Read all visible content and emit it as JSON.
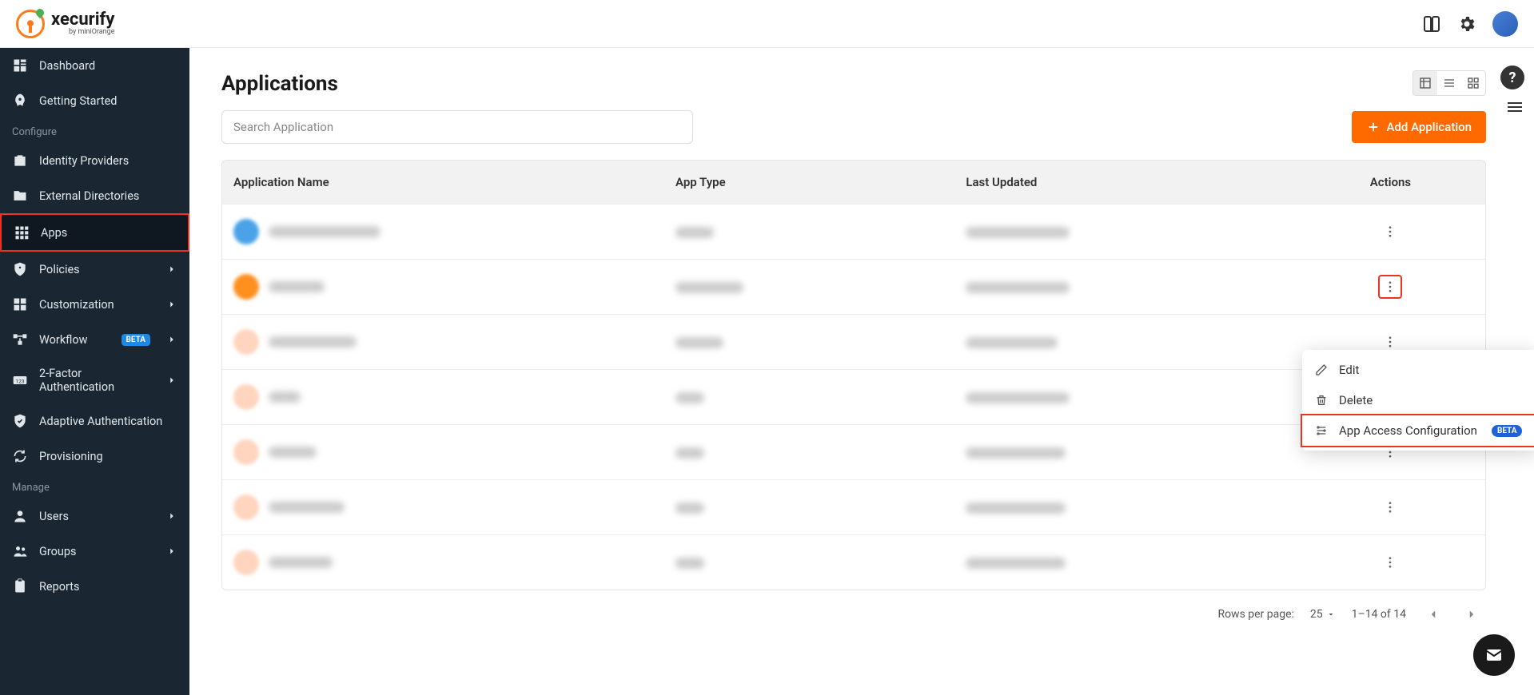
{
  "brand": {
    "name": "xecurify",
    "byline": "by miniOrange"
  },
  "topbar": {},
  "sidebar": {
    "items": [
      {
        "key": "dashboard",
        "label": "Dashboard",
        "icon": "grid"
      },
      {
        "key": "getting-started",
        "label": "Getting Started",
        "icon": "rocket"
      }
    ],
    "configure_label": "Configure",
    "configure": [
      {
        "key": "idp",
        "label": "Identity Providers",
        "icon": "briefcase"
      },
      {
        "key": "ext-dir",
        "label": "External Directories",
        "icon": "folder"
      },
      {
        "key": "apps",
        "label": "Apps",
        "icon": "apps",
        "active": true
      },
      {
        "key": "policies",
        "label": "Policies",
        "icon": "shield",
        "chevron": true
      },
      {
        "key": "custom",
        "label": "Customization",
        "icon": "puzzle",
        "chevron": true
      },
      {
        "key": "workflow",
        "label": "Workflow",
        "icon": "flow",
        "badge": "BETA",
        "chevron": true
      },
      {
        "key": "2fa",
        "label": "2-Factor Authentication",
        "icon": "pin",
        "chevron": true
      },
      {
        "key": "adaptive",
        "label": "Adaptive Authentication",
        "icon": "check-shield"
      },
      {
        "key": "prov",
        "label": "Provisioning",
        "icon": "sync"
      }
    ],
    "manage_label": "Manage",
    "manage": [
      {
        "key": "users",
        "label": "Users",
        "icon": "user",
        "chevron": true
      },
      {
        "key": "groups",
        "label": "Groups",
        "icon": "group",
        "chevron": true
      },
      {
        "key": "reports",
        "label": "Reports",
        "icon": "clipboard"
      }
    ]
  },
  "page": {
    "title": "Applications",
    "search_placeholder": "Search Application",
    "add_button": "Add Application",
    "columns": {
      "name": "Application Name",
      "type": "App Type",
      "updated": "Last Updated",
      "actions": "Actions"
    },
    "rows": [
      {
        "icon_color": "#4aa3e8",
        "name_w": 140,
        "type_w": 48,
        "upd_w": 130,
        "hl": false
      },
      {
        "icon_color": "#ff9020",
        "name_w": 70,
        "type_w": 85,
        "upd_w": 130,
        "hl": true
      },
      {
        "icon_color": "#ffd5c0",
        "name_w": 110,
        "type_w": 60,
        "upd_w": 115,
        "hl": false
      },
      {
        "icon_color": "#ffd5c0",
        "name_w": 40,
        "type_w": 36,
        "upd_w": 130,
        "hl": false
      },
      {
        "icon_color": "#ffd5c0",
        "name_w": 60,
        "type_w": 36,
        "upd_w": 125,
        "hl": false
      },
      {
        "icon_color": "#ffd5c0",
        "name_w": 95,
        "type_w": 36,
        "upd_w": 125,
        "hl": false
      },
      {
        "icon_color": "#ffd5c0",
        "name_w": 80,
        "type_w": 36,
        "upd_w": 125,
        "hl": false
      }
    ],
    "dropdown": {
      "edit": "Edit",
      "delete": "Delete",
      "access": "App Access Configuration",
      "beta": "BETA"
    },
    "pagination": {
      "rows_label": "Rows per page:",
      "rows_value": "25",
      "range": "1–14 of 14"
    }
  }
}
